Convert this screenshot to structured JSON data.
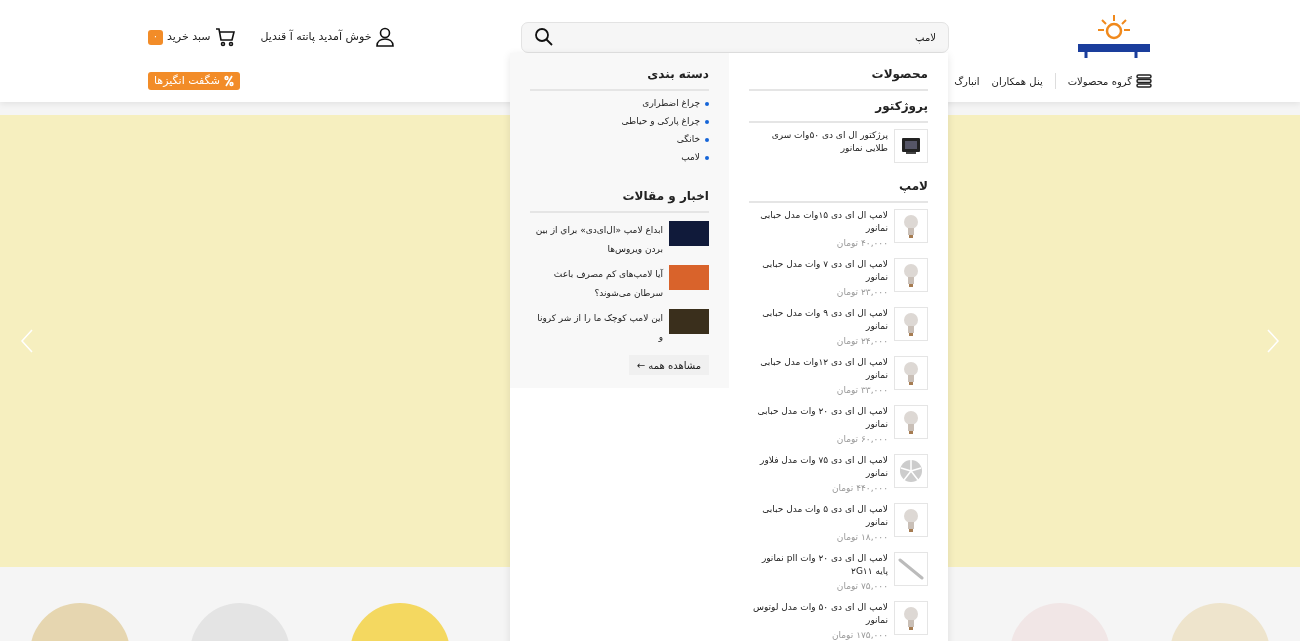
{
  "header": {
    "search": {
      "value": "لامپ"
    },
    "user": {
      "label": "خوش آمدید پانته آ قندیل"
    },
    "cart": {
      "label": "سبد خرید",
      "count": "۰"
    },
    "nav": [
      {
        "label": "گروه محصولات",
        "kind": "menu"
      },
      {
        "label": "پنل همکاران",
        "kind": "link"
      },
      {
        "label": "انبارگ",
        "kind": "link"
      }
    ],
    "promo": {
      "label": "شگفت انگیزها"
    }
  },
  "dropdown": {
    "products": {
      "title": "محصولات",
      "groups": [
        {
          "title": "پروژکتور",
          "items": [
            {
              "name": "پرژکتور ال ای دی ۵۰وات سری طلایی نمانور",
              "kind": "projector"
            }
          ]
        },
        {
          "title": "لامپ",
          "items": [
            {
              "name": "لامپ ال ای دی ۱۵وات مدل حبابی نمانور",
              "price": "۴۰,۰۰۰ تومان",
              "kind": "bulb"
            },
            {
              "name": "لامپ ال ای دی ۷ وات مدل حبابی نمانور",
              "price": "۲۳,۰۰۰ تومان",
              "kind": "bulb"
            },
            {
              "name": "لامپ ال ای دی ۹ وات مدل حبابی نمانور",
              "price": "۲۴,۰۰۰ تومان",
              "kind": "bulb"
            },
            {
              "name": "لامپ ال ای دی ۱۲وات مدل حبابی نمانور",
              "price": "۳۳,۰۰۰ تومان",
              "kind": "bulb"
            },
            {
              "name": "لامپ ال ای دی ۲۰ وات مدل حبابی نمانور",
              "price": "۶۰,۰۰۰ تومان",
              "kind": "bulb"
            },
            {
              "name": "لامپ ال ای دی ۷۵ وات مدل فلاور نمانور",
              "price": "۴۴۰,۰۰۰ تومان",
              "kind": "flower"
            },
            {
              "name": "لامپ ال ای دی ۵ وات مدل حبابی نمانور",
              "price": "۱۸,۰۰۰ تومان",
              "kind": "bulb"
            },
            {
              "name": "لامپ ال ای دی ۲۰ وات pll نمانور پایه ۲G۱۱",
              "price": "۷۵,۰۰۰ تومان",
              "kind": "tube"
            },
            {
              "name": "لامپ ال ای دی ۵۰ وات مدل لوتوس نمانور",
              "price": "۱۷۵,۰۰۰ تومان",
              "kind": "bulb"
            }
          ]
        }
      ]
    },
    "categories": {
      "title": "دسته بندی",
      "items": [
        "چراغ اضطراری",
        "چراغ پارکی و حیاطی",
        "خانگی",
        "لامپ"
      ]
    },
    "news": {
      "title": "اخبار و مقالات",
      "items": [
        "ابداع لامپ «ال‌ای‌دی» براي از بين بردن ويروس‌ها",
        "آیا لامپ‌های کم مصرف باعث سرطان می‌شوند؟",
        "این لامپ کوچک ما را از شر کرونا و"
      ],
      "more": "مشاهده همه ←"
    }
  }
}
